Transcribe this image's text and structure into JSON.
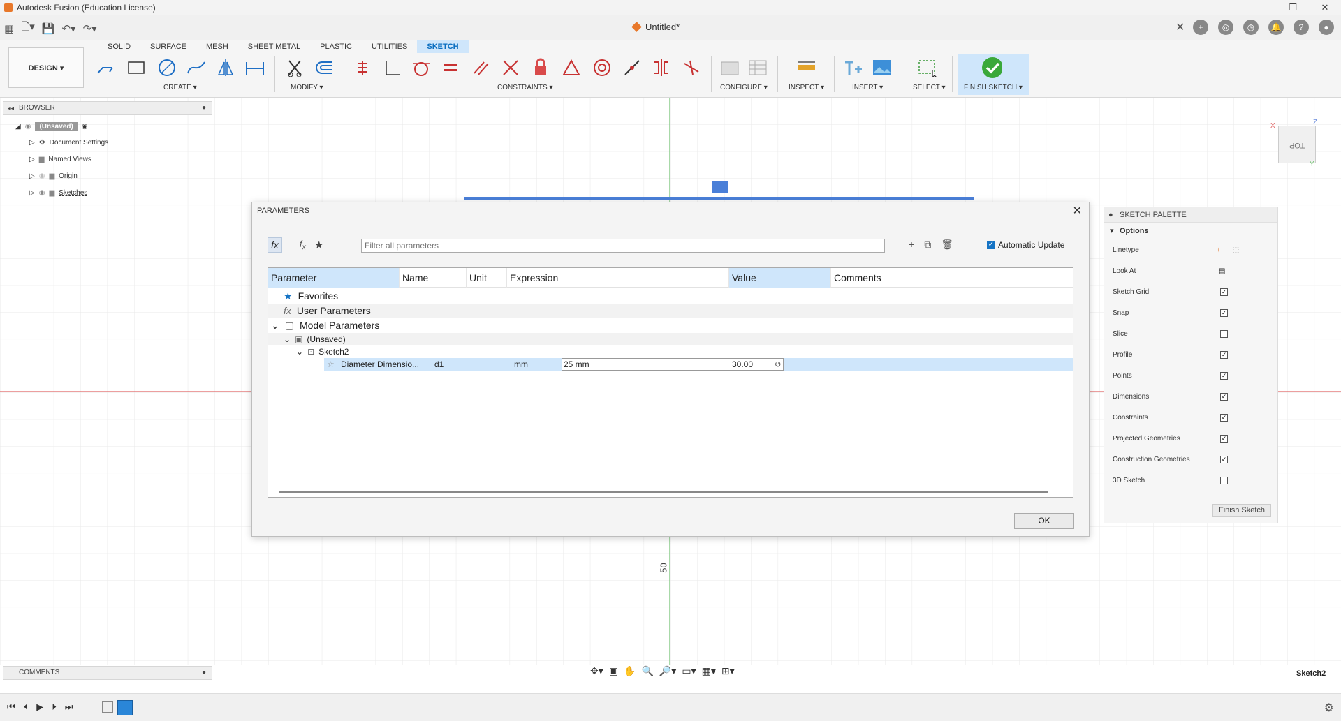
{
  "window": {
    "title": "Autodesk Fusion (Education License)"
  },
  "document": {
    "tab_title": "Untitled*"
  },
  "ribbon": {
    "tabs": [
      "SOLID",
      "SURFACE",
      "MESH",
      "SHEET METAL",
      "PLASTIC",
      "UTILITIES",
      "SKETCH"
    ],
    "active_tab": "SKETCH",
    "workspace": "DESIGN ▾",
    "groups": {
      "create": "CREATE ▾",
      "modify": "MODIFY ▾",
      "constraints": "CONSTRAINTS ▾",
      "configure": "CONFIGURE ▾",
      "inspect": "INSPECT ▾",
      "insert": "INSERT ▾",
      "select": "SELECT ▾",
      "finish_sketch": "FINISH SKETCH ▾"
    }
  },
  "browser": {
    "title": "BROWSER",
    "items": [
      {
        "label": "(Unsaved)"
      },
      {
        "label": "Document Settings"
      },
      {
        "label": "Named Views"
      },
      {
        "label": "Origin"
      },
      {
        "label": "Sketches"
      }
    ]
  },
  "canvas": {
    "dimension_label": "50"
  },
  "parameters_dialog": {
    "title": "PARAMETERS",
    "filter_placeholder": "Filter all parameters",
    "automatic_update_label": "Automatic Update",
    "automatic_update_checked": true,
    "columns": [
      "Parameter",
      "Name",
      "Unit",
      "Expression",
      "Value",
      "Comments"
    ],
    "groups": {
      "favorites": "Favorites",
      "user_parameters": "User Parameters",
      "model_parameters": "Model Parameters",
      "component": "(Unsaved)",
      "sketch": "Sketch2"
    },
    "rows": [
      {
        "parameter": "Diameter Dimensio...",
        "name": "d1",
        "unit": "mm",
        "expression": "25 mm",
        "value": "30.00",
        "comments": ""
      }
    ],
    "ok_label": "OK"
  },
  "sketch_palette": {
    "title": "SKETCH PALETTE",
    "section": "Options",
    "options": [
      {
        "label": "Linetype",
        "checkbox": null
      },
      {
        "label": "Look At",
        "checkbox": null
      },
      {
        "label": "Sketch Grid",
        "checkbox": true
      },
      {
        "label": "Snap",
        "checkbox": true
      },
      {
        "label": "Slice",
        "checkbox": false
      },
      {
        "label": "Profile",
        "checkbox": true
      },
      {
        "label": "Points",
        "checkbox": true
      },
      {
        "label": "Dimensions",
        "checkbox": true
      },
      {
        "label": "Constraints",
        "checkbox": true
      },
      {
        "label": "Projected Geometries",
        "checkbox": true
      },
      {
        "label": "Construction Geometries",
        "checkbox": true
      },
      {
        "label": "3D Sketch",
        "checkbox": false
      }
    ],
    "finish_label": "Finish Sketch"
  },
  "view_cube": {
    "face": "TOP",
    "axes": [
      "X",
      "Z",
      "Y"
    ]
  },
  "comments": {
    "title": "COMMENTS"
  },
  "status": {
    "active_sketch": "Sketch2"
  },
  "colors": {
    "accent": "#0a6ec0",
    "active_tab_bg": "#cfe6fb",
    "selection_row": "#cfe6fb",
    "x_axis": "#e06666",
    "y_axis": "#6fc06f",
    "finish_check": "#3aa83a"
  }
}
